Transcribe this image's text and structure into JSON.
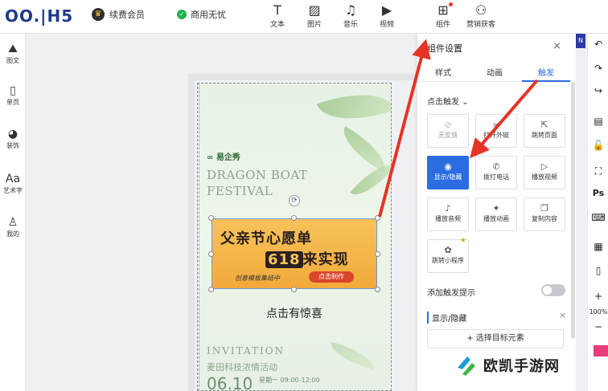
{
  "topbar": {
    "logo": "OO.|H5",
    "member_label": "续费会员",
    "license_label": "商用无忧",
    "tools": [
      {
        "label": "文本",
        "icon": "text-icon"
      },
      {
        "label": "图片",
        "icon": "image-icon"
      },
      {
        "label": "音乐",
        "icon": "music-icon"
      },
      {
        "label": "视频",
        "icon": "video-icon"
      },
      {
        "label": "组件",
        "icon": "component-icon"
      },
      {
        "label": "营销获客",
        "icon": "users-icon"
      }
    ]
  },
  "sidebar": {
    "items": [
      {
        "label": "图文",
        "icon": "mountain-icon"
      },
      {
        "label": "单页",
        "icon": "page-icon"
      },
      {
        "label": "装饰",
        "icon": "palette-icon"
      },
      {
        "label": "艺术字",
        "icon": "font-icon"
      },
      {
        "label": "我的",
        "icon": "user-icon"
      }
    ]
  },
  "poster": {
    "brand": "易企秀",
    "title_line1": "DRAGON BOAT",
    "title_line2": "FESTIVAL",
    "banner_line1": "父亲节心愿单",
    "banner_618": "618",
    "banner_line2_rest": "来实现",
    "banner_sub": "创意模板集结中",
    "banner_button": "点击制作",
    "cta": "点击有惊喜",
    "invitation": "INVITATION",
    "event": "麦田科技浓情活动",
    "date": "06.10",
    "time": "星期一 09:00-12:00"
  },
  "panel": {
    "title": "组件设置",
    "close": "×",
    "tabs": [
      "样式",
      "动画",
      "触发"
    ],
    "active_tab": "触发",
    "trigger_head": "点击触发 ⌄",
    "actions": [
      {
        "label": "无反馈",
        "icon": "ban-icon"
      },
      {
        "label": "打开外链",
        "icon": "link-icon"
      },
      {
        "label": "跳转页面",
        "icon": "jump-icon"
      },
      {
        "label": "显示/隐藏",
        "icon": "eye-icon"
      },
      {
        "label": "拨打电话",
        "icon": "phone-icon"
      },
      {
        "label": "播放视频",
        "icon": "play-icon"
      },
      {
        "label": "播放音频",
        "icon": "audio-icon"
      },
      {
        "label": "播放动画",
        "icon": "animation-icon"
      },
      {
        "label": "复制内容",
        "icon": "copy-icon"
      },
      {
        "label": "跳转小程序",
        "icon": "miniprogram-icon"
      }
    ],
    "hint_label": "添加触发提示",
    "section_title": "显示/隐藏",
    "section_close": "×",
    "select_target": "+ 选择目标元素"
  },
  "rightbar": {
    "zoom": "100%",
    "items": [
      "↶",
      "↷",
      "↪",
      "▤",
      "🔓",
      "⛶",
      "Ps",
      "⌨",
      "▦",
      "▯",
      "+",
      "−"
    ]
  },
  "watermark": {
    "text": "欧凯手游网"
  },
  "colors": {
    "accent": "#2b6de0",
    "arrow": "#e53325",
    "banner": "#f2b040"
  }
}
